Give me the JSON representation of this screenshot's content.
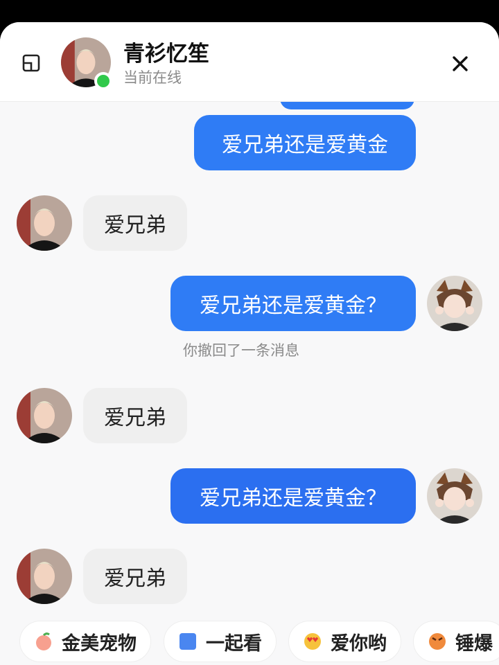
{
  "header": {
    "contact_name": "青衫忆笙",
    "status_text": "当前在线",
    "minimize_icon": "minimize-window-icon",
    "close_icon": "close-icon"
  },
  "colors": {
    "outgoing_bubble": "#2f7cf5",
    "incoming_bubble": "#efefef",
    "online_dot": "#31c94b"
  },
  "messages": [
    {
      "direction": "out",
      "text": "爱兄弟还是爱黄金"
    },
    {
      "direction": "in",
      "text": "爱兄弟"
    },
    {
      "direction": "out",
      "text": "爱兄弟还是爱黄金？"
    },
    {
      "system": "你撤回了一条消息"
    },
    {
      "direction": "in",
      "text": "爱兄弟"
    },
    {
      "direction": "out",
      "text": "爱兄弟还是爱黄金？"
    },
    {
      "direction": "in",
      "text": "爱兄弟"
    }
  ],
  "quick_actions": [
    {
      "label": "金美宠物",
      "icon": "peach-icon"
    },
    {
      "label": "一起看",
      "icon": "blue-square-icon"
    },
    {
      "label": "爱你哟",
      "icon": "heart-eyes-emoji-icon"
    },
    {
      "label": "锤爆",
      "icon": "angry-emoji-icon"
    }
  ]
}
